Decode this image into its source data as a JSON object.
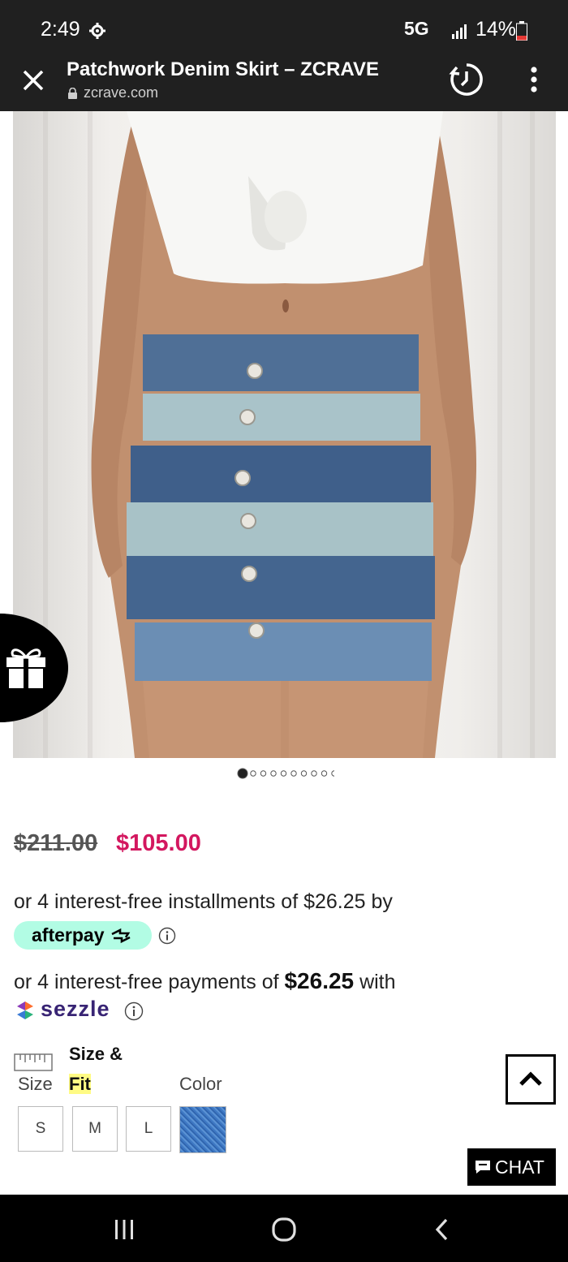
{
  "status_bar": {
    "time": "2:49",
    "network": "5G",
    "battery": "14%"
  },
  "browser": {
    "title": "Patchwork Denim Skirt – ZCRAVE",
    "url": "zcrave.com"
  },
  "gallery": {
    "image_alt": "Patchwork Denim Skirt",
    "dot_count": 10,
    "active_dot": 0
  },
  "pricing": {
    "original": "$211.00",
    "sale": "$105.00",
    "sale_color": "#d3175f"
  },
  "afterpay": {
    "text": "or 4 interest-free installments of $26.25 by",
    "badge": "afterpay",
    "badge_color": "#b2fce4"
  },
  "sezzle": {
    "text_before": "or 4 interest-free payments of ",
    "amount": "$26.25",
    "text_after": " with",
    "logo": "sezzle"
  },
  "options": {
    "size_label": "Size",
    "size_fit_line1": "Size &",
    "size_fit_line2": "Fit",
    "color_label": "Color",
    "sizes": [
      "S",
      "M",
      "L"
    ]
  },
  "chat": {
    "label": "CHAT"
  }
}
